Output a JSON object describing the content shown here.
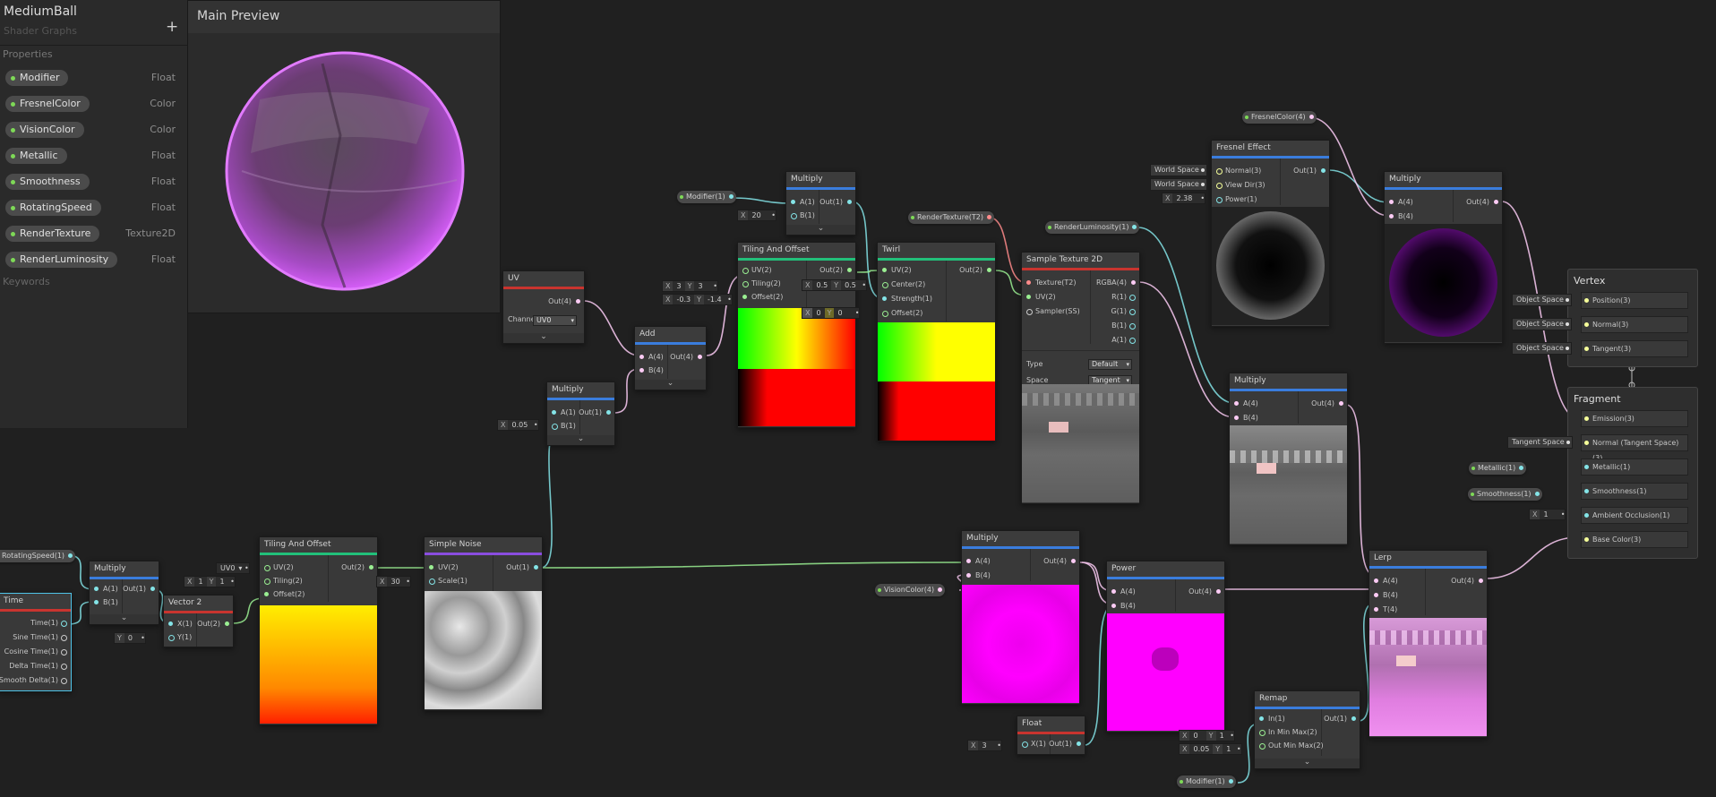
{
  "colors": {
    "float": "#84e4e7",
    "vector2": "#9aef92",
    "vector3": "#f6ff9a",
    "vector4": "#fbcbf4",
    "texture": "#ff8b8b",
    "sampler": "#9a9a9a"
  },
  "blackboard": {
    "title": "MediumBall",
    "subtitle": "Shader Graphs",
    "add_icon": "+",
    "properties_header": "Properties",
    "keywords_header": "Keywords",
    "properties": [
      {
        "name": "Modifier",
        "type": "Float"
      },
      {
        "name": "FresnelColor",
        "type": "Color"
      },
      {
        "name": "VisionColor",
        "type": "Color"
      },
      {
        "name": "Metallic",
        "type": "Float"
      },
      {
        "name": "Smoothness",
        "type": "Float"
      },
      {
        "name": "RotatingSpeed",
        "type": "Float"
      },
      {
        "name": "RenderTexture",
        "type": "Texture2D"
      },
      {
        "name": "RenderLuminosity",
        "type": "Float"
      }
    ]
  },
  "main_preview": {
    "title": "Main Preview"
  },
  "nodes": {
    "time": {
      "title": "Time",
      "outputs": [
        "Time(1)",
        "Sine Time(1)",
        "Cosine Time(1)",
        "Delta Time(1)",
        "Smooth Delta(1)"
      ]
    },
    "multiply_a": {
      "title": "Multiply",
      "in_a": "A(1)",
      "in_b": "B(1)",
      "out": "Out(1)"
    },
    "vector2": {
      "title": "Vector 2",
      "in_x": "X(1)",
      "in_y": "Y(1)",
      "out": "Out(2)",
      "y_label": "Y",
      "y_value": "0"
    },
    "tiling_a": {
      "title": "Tiling And Offset",
      "in_uv": "UV(2)",
      "in_tiling": "Tiling(2)",
      "in_offset": "Offset(2)",
      "out": "Out(2)",
      "uv_value": "UV0",
      "x_label": "X",
      "x_value": "1",
      "y_label": "Y",
      "y_value": "1"
    },
    "noise": {
      "title": "Simple Noise",
      "in_uv": "UV(2)",
      "in_scale": "Scale(1)",
      "out": "Out(1)",
      "x_label": "X",
      "scale_value": "30"
    },
    "uv": {
      "title": "UV",
      "out": "Out(4)",
      "channel_label": "Channel",
      "channel_value": "UV0"
    },
    "multiply_b": {
      "title": "Multiply",
      "in_a": "A(1)",
      "in_b": "B(1)",
      "out": "Out(1)",
      "x_label": "X",
      "b_value": "0.05"
    },
    "add": {
      "title": "Add",
      "in_a": "A(4)",
      "in_b": "B(4)",
      "out": "Out(4)"
    },
    "multiply_c": {
      "title": "Multiply",
      "in_a": "A(1)",
      "in_b": "B(1)",
      "out": "Out(1)",
      "x_label": "X",
      "b_value": "20"
    },
    "tiling_b": {
      "title": "Tiling And Offset",
      "in_uv": "UV(2)",
      "in_tiling": "Tiling(2)",
      "in_offset": "Offset(2)",
      "out": "Out(2)",
      "x_label": "X",
      "y_label": "Y",
      "tiling_x": "3",
      "tiling_y": "3",
      "offset_x": "-0.3",
      "offset_y": "-1.4"
    },
    "twirl": {
      "title": "Twirl",
      "in_uv": "UV(2)",
      "in_center": "Center(2)",
      "in_strength": "Strength(1)",
      "in_offset": "Offset(2)",
      "out": "Out(2)",
      "x_label": "X",
      "y_label": "Y",
      "center_x": "0.5",
      "center_y": "0.5",
      "offset_x": "0",
      "offset_y": "0"
    },
    "sample": {
      "title": "Sample Texture 2D",
      "in_tex": "Texture(T2)",
      "in_uv": "UV(2)",
      "in_sampler": "Sampler(SS)",
      "outs": [
        "RGBA(4)",
        "R(1)",
        "G(1)",
        "B(1)",
        "A(1)"
      ],
      "type_label": "Type",
      "type_value": "Default",
      "space_label": "Space",
      "space_value": "Tangent"
    },
    "fresnel": {
      "title": "Fresnel Effect",
      "in_normal": "Normal(3)",
      "in_view": "View Dir(3)",
      "in_power": "Power(1)",
      "out": "Out(1)",
      "normal_space": "World Space",
      "view_space": "World Space",
      "x_label": "X",
      "power_value": "2.38"
    },
    "multiply_d": {
      "title": "Multiply",
      "in_a": "A(4)",
      "in_b": "B(4)",
      "out": "Out(4)"
    },
    "multiply_e": {
      "title": "Multiply",
      "in_a": "A(4)",
      "in_b": "B(4)",
      "out": "Out(4)"
    },
    "multiply_f": {
      "title": "Multiply",
      "in_a": "A(4)",
      "in_b": "B(4)",
      "out": "Out(4)"
    },
    "power": {
      "title": "Power",
      "in_a": "A(4)",
      "in_b": "B(4)",
      "out": "Out(4)"
    },
    "float": {
      "title": "Float",
      "in_x": "X(1)",
      "out": "Out(1)",
      "x_label": "X",
      "x_value": "3"
    },
    "remap": {
      "title": "Remap",
      "in": "In(1)",
      "in_minmax": "In Min Max(2)",
      "out_minmax": "Out Min Max(2)",
      "out": "Out(1)",
      "x_label": "X",
      "y_label": "Y",
      "in_min": "0",
      "in_max": "1",
      "out_min": "0.05",
      "out_max": "1"
    },
    "lerp": {
      "title": "Lerp",
      "in_a": "A(4)",
      "in_b": "B(4)",
      "in_t": "T(4)",
      "out": "Out(4)"
    }
  },
  "property_nodes": {
    "rotating_speed": "RotatingSpeed(1)",
    "modifier_top": "Modifier(1)",
    "render_texture": "RenderTexture(T2)",
    "render_luminosity": "RenderLuminosity(1)",
    "fresnel_color": "FresnelColor(4)",
    "vision_color": "VisionColor(4)",
    "metallic": "Metallic(1)",
    "smoothness": "Smoothness(1)",
    "modifier_bottom": "Modifier(1)"
  },
  "master": {
    "vertex_title": "Vertex",
    "vertex_slots": [
      "Position(3)",
      "Normal(3)",
      "Tangent(3)"
    ],
    "vertex_spaces": [
      "Object Space",
      "Object Space",
      "Object Space"
    ],
    "fragment_title": "Fragment",
    "fragment_slots": [
      "Emission(3)",
      "Normal (Tangent Space)(3)",
      "Metallic(1)",
      "Smoothness(1)",
      "Ambient Occlusion(1)",
      "Base Color(3)"
    ],
    "normal_space": "Tangent Space",
    "ao_label": "X",
    "ao_value": "1"
  }
}
